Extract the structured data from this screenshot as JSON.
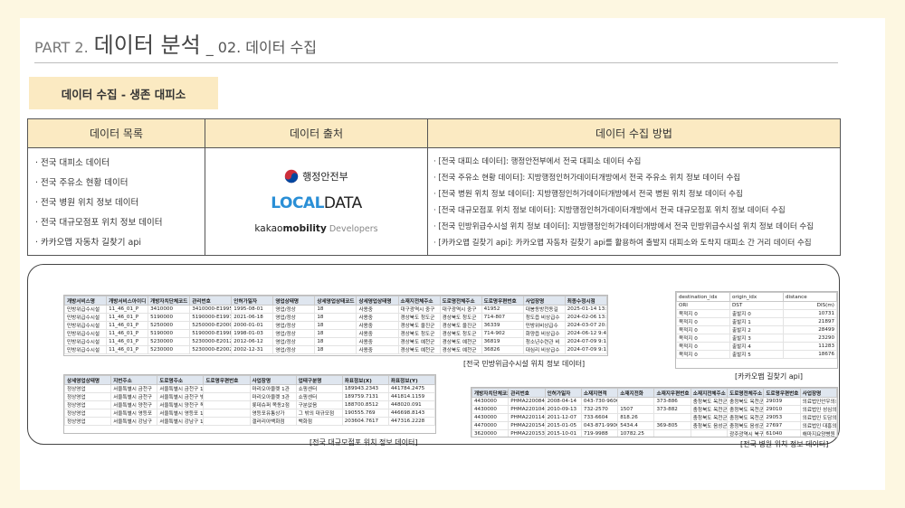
{
  "header": {
    "part": "PART 2.",
    "main": "데이터 분석",
    "sub": "_ 02. 데이터 수집"
  },
  "badge": "데이터 수집 - 생존 대피소",
  "info_table": {
    "headers": [
      "데이터 목록",
      "데이터 출처",
      "데이터 수집 방법"
    ],
    "list": [
      "· 전국 대피소 데이터",
      "· 전국 주유소 현황 데이터",
      "· 전국 병원 위치 정보 데이터",
      "· 전국 대규모점포 위치 정보 데이터",
      "· 카카오맵 자동차 길찾기 api"
    ],
    "sources": {
      "mois": "행정안전부",
      "localdata_a": "LOCAL",
      "localdata_b": "DATA",
      "kakao_a": "kakao",
      "kakao_b": "mobility",
      "kakao_c": "Developers"
    },
    "methods": [
      "· [전국 대피소 데이터]: 행정안전부에서 전국 대피소 데이터 수집",
      "· [전국 주유소 현황 데이터]: 지방행정인허가데이터개방에서 전국 주유소 위치 정보 데이터 수집",
      "· [전국 병원 위치 정보 데이터]: 지방행정인허가데이터개방에서 전국 병원 위치 정보 데이터 수집",
      "· [전국 대규모점포 위치 정보 데이터]: 지방행정인허가데이터개방에서 전국 대규모점포 위치 정보 데이터 수집",
      "· [전국 민방위급수시설 위치 정보 데이터]: 지방행정인허가데이터개방에서 전국 민방위급수시설 위치 정보 데이터 수집",
      "· [카카오맵 길찾기 api]: 카카오맵 자동차 길찾기 api를 활용하여 출발지 대피소와 도착지 대피소 간 거리 데이터 수집"
    ]
  },
  "shot_water": {
    "caption": "[전국 민방위급수시설 위치 정보 데이터]",
    "headers": [
      "개방서비스명",
      "개방서비스아이디",
      "개방자치단체코드",
      "관리번호",
      "인허가일자",
      "영업상태명",
      "상세영업상태코드",
      "상세영업상태명",
      "소재지전체주소",
      "도로명전체주소",
      "도로명우편번호",
      "사업장명",
      "최종수정시점"
    ],
    "rows": [
      [
        "민방위급수시설",
        "11_46_01_P",
        "3410000",
        "3410000-E19950",
        "1995-08-01",
        "영업/정상",
        "18",
        "사용중",
        "대구광역시 중구",
        "대구광역시 중구",
        "41952",
        "대봉동방천동길",
        "2025-01-14 13:5"
      ],
      [
        "민방위급수시설",
        "11_46_01_P",
        "5190000",
        "5190000-E19970",
        "2021-06-18",
        "영업/정상",
        "18",
        "사용중",
        "경상북도 청도군",
        "경상북도 청도군",
        "714-807",
        "청도읍 비상급수",
        "2024-02-06 13:4"
      ],
      [
        "민방위급수시설",
        "11_46_01_P",
        "5250000",
        "5250000-E20000",
        "2000-01-01",
        "영업/정상",
        "18",
        "사용중",
        "경상북도 울진군",
        "경상북도 울진군",
        "36339",
        "민방위비상급수",
        "2024-03-07 20:0"
      ],
      [
        "민방위급수시설",
        "11_46_01_P",
        "5190000",
        "5190000-E19980",
        "1998-01-03",
        "영업/정상",
        "18",
        "사용중",
        "경상북도 청도군",
        "경상북도 청도군",
        "714-902",
        "화양읍 비상급수",
        "2024-06-12 9:40"
      ],
      [
        "민방위급수시설",
        "11_46_01_P",
        "5230000",
        "5230000-E20120",
        "2012-06-12",
        "영업/정상",
        "18",
        "사용중",
        "경상북도 예천군",
        "경상북도 예천군",
        "36819",
        "청소년수련관 비",
        "2024-07-09 9:18"
      ],
      [
        "민방위급수시설",
        "11_46_01_P",
        "5230000",
        "5230000-E20020",
        "2002-12-31",
        "영업/정상",
        "18",
        "사용중",
        "경상북도 예천군",
        "경상북도 예천군",
        "36826",
        "대심리 비상급수",
        "2024-07-09 9:18"
      ]
    ]
  },
  "shot_dist": {
    "caption": "[카카오맵 길찾기 api]",
    "headers": [
      "destination_idx",
      "origin_idx",
      "distance"
    ],
    "rows": [
      [
        "ORI",
        "DST",
        "DIS(m)"
      ],
      [
        "목적지 0",
        "출발지 0",
        "10731"
      ],
      [
        "목적지 0",
        "출발지 1",
        "21897"
      ],
      [
        "목적지 0",
        "출발지 2",
        "28499"
      ],
      [
        "목적지 0",
        "출발지 3",
        "23290"
      ],
      [
        "목적지 0",
        "출발지 4",
        "11283"
      ],
      [
        "목적지 0",
        "출발지 5",
        "18676"
      ]
    ]
  },
  "shot_store": {
    "caption": "[전국 대규모점포 위치 정보 데이터]",
    "headers": [
      "상세영업상태명",
      "지번주소",
      "도로명주소",
      "도로명우편번호",
      "사업장명",
      "업태구분명",
      "좌표정보(X)",
      "좌표정보(Y)"
    ],
    "rows": [
      [
        "정상영업",
        "서울특별시 금천구",
        "서울특별시 금천구 153-801",
        "",
        "마리오아울렛 1관",
        "쇼핑센터",
        "189943.2343",
        "441784.2475"
      ],
      [
        "정상영업",
        "서울특별시 금천구",
        "서울특별시 금천구 벚꽃로 266 (가산",
        "",
        "마리오아울렛 3관",
        "쇼핑센터",
        "189759.7131",
        "441814.1159"
      ],
      [
        "정상영업",
        "서울특별시 양천구",
        "서울특별시 양천구 목동서로 100, 1층",
        "",
        "롯데슈퍼 목동2점",
        "구분없음",
        "188700.8512",
        "448020.091"
      ],
      [
        "정상영업",
        "서울특별시 영등포",
        "서울특별시 영등포 158-723",
        "",
        "영등포유통상가",
        "그 밖의 대규모점",
        "190555.769",
        "446698.8143"
      ],
      [
        "정상영업",
        "서울특별시 강남구",
        "서울특별시 강남구 135-902",
        "",
        "갤러리아백화점",
        "백화점",
        "203604.7617",
        "447316.2228"
      ]
    ]
  },
  "shot_hospital": {
    "caption": "[전국 병원 위치 정보 데이터]",
    "headers": [
      "개방자치단체코드",
      "관리번호",
      "인허가일자",
      "소재지면적",
      "소재지전화",
      "소재지우편번호",
      "소재지전체주소",
      "도로명전체주소",
      "도로명우편번호",
      "사업장명"
    ],
    "rows": [
      [
        "4430000",
        "PHMA22008443",
        "2008-04-14",
        "043-730-9600",
        "",
        "373-886",
        "충청북도 옥천군",
        "충청북도 옥천군",
        "29039",
        "의료법인안우의료"
      ],
      [
        "4430000",
        "PHMA22010443",
        "2010-09-13",
        "732-2570",
        "1507",
        "373-882",
        "충청북도 옥천군",
        "충청북도 옥천군",
        "29010",
        "의료법인 성심의"
      ],
      [
        "4430000",
        "PHMA22011443",
        "2011-12-07",
        "733-6604",
        "818.26",
        "",
        "충청북도 옥천군",
        "충청북도 옥천군",
        "29053",
        "의료법인 도담의료"
      ],
      [
        "4470000",
        "PHMA22015447",
        "2015-01-05",
        "043-871-9900",
        "5434.4",
        "369-805",
        "충청북도 음성군",
        "충청북도 음성군",
        "27697",
        "의료법인 대흥의료"
      ],
      [
        "3620000",
        "PHMA22015362",
        "2015-10-01",
        "719-9988",
        "10782.25",
        "",
        "",
        "광주광역시 북구",
        "61040",
        "해마지요양병원"
      ]
    ]
  }
}
